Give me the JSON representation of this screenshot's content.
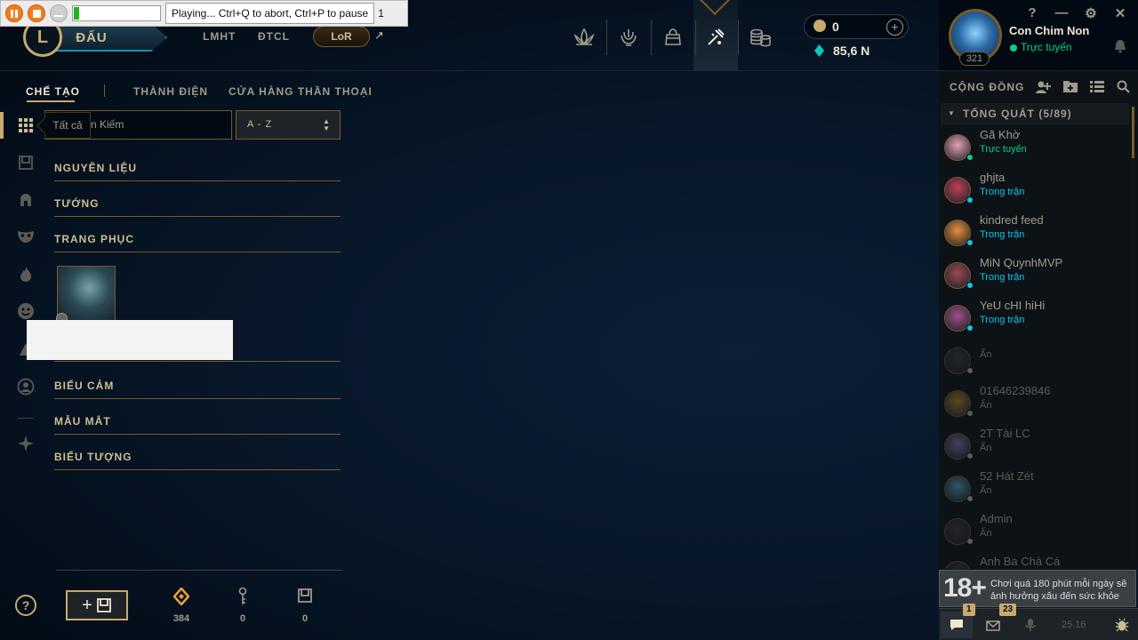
{
  "recorder": {
    "status_text": "Playing... Ctrl+Q to abort, Ctrl+P to pause",
    "counter": "1",
    "progress_fraction": 0.06
  },
  "nav": {
    "play_label": "ĐẤU",
    "logo_letter": "L",
    "links": [
      "LMHT",
      "ĐTCL"
    ],
    "lor_label": "LoR",
    "external_arrow": "↗"
  },
  "wallet": {
    "rp": "0",
    "be": "85,6 N",
    "add_symbol": "+"
  },
  "profile": {
    "name": "Con Chim Non",
    "status": "Trực tuyến",
    "level": "321",
    "controls": [
      "?",
      "—",
      "⚙",
      "✕"
    ]
  },
  "loot": {
    "tabs": [
      "CHẾ TẠO",
      "THÀNH ĐIỆN",
      "CỬA HÀNG THẦN THOẠI"
    ],
    "search_placeholder": "n Kiếm",
    "tooltip": "Tất cả",
    "sort_label": "A - Z",
    "categories": [
      "NGUYÊN LIỆU",
      "TƯỚNG",
      "TRANG PHỤC",
      "BIỂU CẢM",
      "MẪU MẮT",
      "BIỂU TƯỢNG"
    ],
    "help_symbol": "?",
    "add_symbol": "+",
    "resources": [
      {
        "icon": "orange-essence-icon",
        "value": "384",
        "color": "#f0a03c"
      },
      {
        "icon": "key-fragment-icon",
        "value": "0",
        "color": "#a09b8c"
      },
      {
        "icon": "chest-icon",
        "value": "0",
        "color": "#a09b8c"
      }
    ]
  },
  "social": {
    "title": "CỘNG ĐỒNG",
    "group_label": "TỔNG QUÁT (5/89)",
    "friends": [
      {
        "name": "Gã Khờ",
        "status": "Trực tuyến",
        "state": "online",
        "avatar_color": "#e6a0b4"
      },
      {
        "name": "ghjta",
        "status": "Trong trận",
        "state": "ingame",
        "avatar_color": "#c0405a"
      },
      {
        "name": "kindred feed",
        "status": "Trong trận",
        "state": "ingame",
        "avatar_color": "#e8903a"
      },
      {
        "name": "MiN QuynhMVP",
        "status": "Trong trận",
        "state": "ingame",
        "avatar_color": "#9a4a50"
      },
      {
        "name": "YeU cHI hiHi",
        "status": "Trong trận",
        "state": "ingame",
        "avatar_color": "#a04e8a"
      },
      {
        "name": "",
        "status": "Ẩn",
        "state": "offline",
        "avatar_color": "#3c3c41"
      },
      {
        "name": "01646239846",
        "status": "Ẩn",
        "state": "offline",
        "avatar_color": "#b8902e"
      },
      {
        "name": "2T Tài LC",
        "status": "Ẩn",
        "state": "offline",
        "avatar_color": "#8a7ab0"
      },
      {
        "name": "52 Hát Zét",
        "status": "Ẩn",
        "state": "offline",
        "avatar_color": "#5aa8c8"
      },
      {
        "name": "Admin",
        "status": "Ẩn",
        "state": "offline",
        "avatar_color": "#3c3c41"
      },
      {
        "name": "Anh Ba Chà Cá",
        "status": "",
        "state": "offline",
        "avatar_color": "#3c3c41"
      }
    ],
    "age_badge": "18+",
    "age_notice": "Chơi quá 180 phút mỗi ngày sẽ ảnh hưởng xấu đến sức khỏe",
    "chat_badge": "1",
    "mail_badge": "23",
    "version": "25.16"
  },
  "colors": {
    "online": "#0acf83",
    "ingame": "#0ac8e6",
    "offline": "#5b5a56",
    "gold": "#c8aa6e"
  }
}
